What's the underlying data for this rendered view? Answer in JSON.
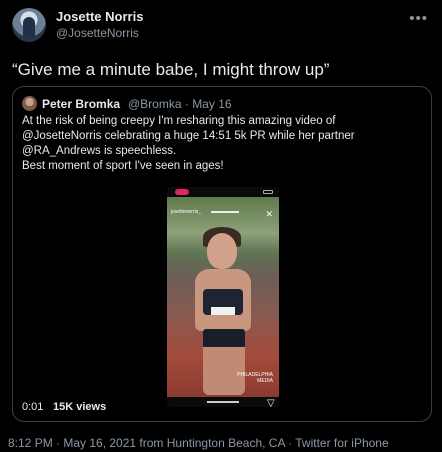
{
  "author": {
    "name": "Josette Norris",
    "handle": "@JosetteNorris",
    "more_icon": "ellipsis-icon"
  },
  "tweet": {
    "text": "“Give me a minute babe, I might throw up”"
  },
  "quote": {
    "name": "Peter Bromka",
    "meta": "@Bromka · May 16",
    "lines": [
      "At the risk of being creepy I'm resharing this amazing video of",
      "@JosetteNorris celebrating a huge 14:51 5k PR while her partner",
      "@RA_Andrews is speechless.",
      "Best moment of sport I've seen in ages!"
    ]
  },
  "video": {
    "top_label": "josettenorris_",
    "overlay_line1": "PHILADELPHIA",
    "overlay_line2": "MEDIA",
    "time": "0:01",
    "views": "15K views",
    "mute_icon": "volume-icon"
  },
  "footer": {
    "text": "8:12 PM · May 16, 2021 from Huntington Beach, CA · Twitter for iPhone"
  }
}
